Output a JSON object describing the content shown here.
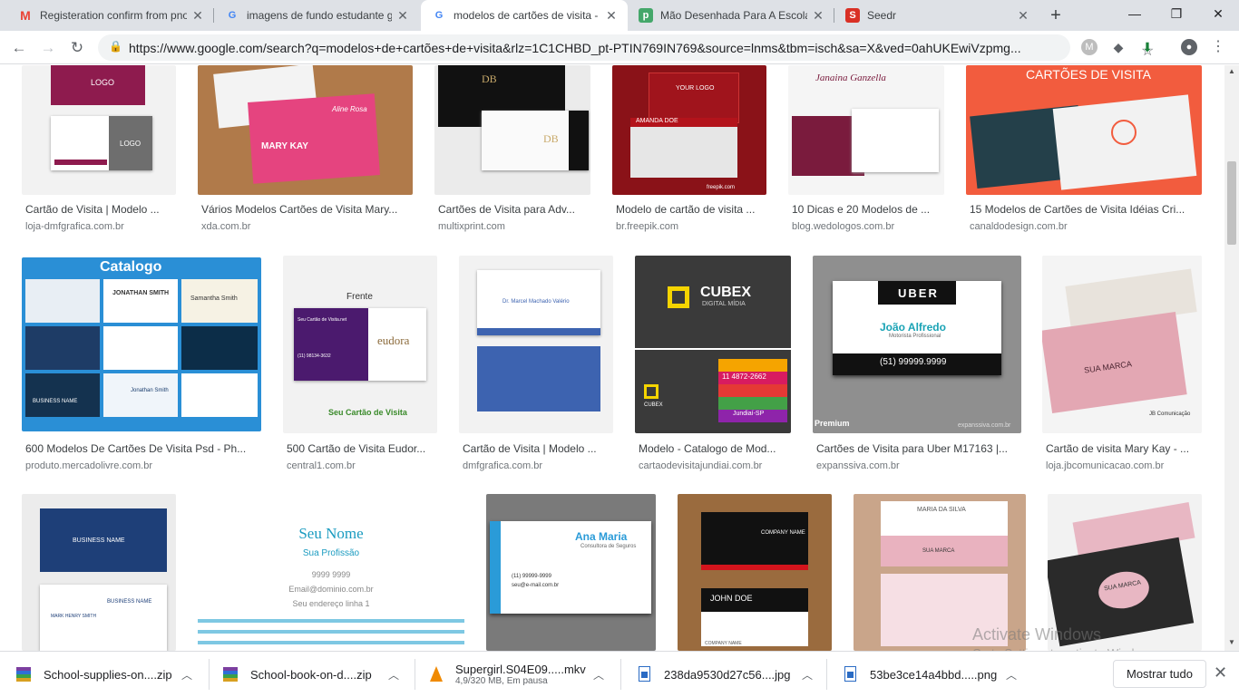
{
  "tabs": [
    {
      "title": "Registeration confirm from pno",
      "icon": "gmail-icon"
    },
    {
      "title": "imagens de fundo estudante g",
      "icon": "google-icon"
    },
    {
      "title": "modelos de cartões de visita -",
      "icon": "google-icon"
    },
    {
      "title": "Mão Desenhada Para A Escola",
      "icon": "freepik-icon"
    },
    {
      "title": "Seedr",
      "icon": "seedr-icon"
    }
  ],
  "url": "https://www.google.com/search?q=modelos+de+cartões+de+visita&rlz=1C1CHBD_pt-PTIN769IN769&source=lnms&tbm=isch&sa=X&ved=0ahUKEwiVzpmg...",
  "results": [
    {
      "caption": "Cartão de Visita | Modelo ...",
      "domain": "loja-dmfgrafica.com.br",
      "texts": [
        "LOGO",
        "LOGO"
      ]
    },
    {
      "caption": "Vários Modelos Cartões de Visita Mary...",
      "domain": "xda.com.br",
      "texts": [
        "MARY KAY",
        "Aline Rosa"
      ]
    },
    {
      "caption": "Cartões de Visita para Adv...",
      "domain": "multixprint.com",
      "texts": [
        "DB",
        "DB"
      ]
    },
    {
      "caption": "Modelo de cartão de visita ...",
      "domain": "br.freepik.com",
      "texts": [
        "YOUR LOGO",
        "AMANDA DOE",
        "freepik.com"
      ]
    },
    {
      "caption": "10 Dicas e 20 Modelos de ...",
      "domain": "blog.wedologos.com.br",
      "texts": [
        "Janaina Ganzella"
      ]
    },
    {
      "caption": "15 Modelos de Cartões de Visita Idéias Cri...",
      "domain": "canaldodesign.com.br",
      "texts": [
        "CARTÕES DE VISITA"
      ]
    },
    {
      "caption": "600 Modelos De Cartões De Visita Psd - Ph...",
      "domain": "produto.mercadolivre.com.br",
      "texts": [
        "Catalogo",
        "JONATHAN SMITH",
        "Samantha Smith",
        "Jonathan Smith",
        "BUSINESS NAME"
      ]
    },
    {
      "caption": "500 Cartão de Visita Eudor...",
      "domain": "central1.com.br",
      "texts": [
        "Frente",
        "Seu Cartão de Visita.net",
        "eudora",
        "(11) 98134-3632",
        "Seu Cartão de Visita"
      ]
    },
    {
      "caption": "Cartão de Visita | Modelo ...",
      "domain": "dmfgrafica.com.br",
      "texts": [
        "Dr. Marcel Machado Valério"
      ]
    },
    {
      "caption": "Modelo - Catalogo de Mod...",
      "domain": "cartaodevisitajundiai.com.br",
      "texts": [
        "CUBEX",
        "DIGITAL MÍDIA",
        "11 4872-2662",
        "CUBEX",
        "Jundiaí-SP"
      ]
    },
    {
      "caption": "Cartões de Visita para Uber M17163 |...",
      "domain": "expanssiva.com.br",
      "texts": [
        "UBER",
        "João Alfredo",
        "Motorista Profissional",
        "(51) 99999.9999",
        "Premium",
        "expanssiva.com.br"
      ]
    },
    {
      "caption": "Cartão de visita Mary Kay - ...",
      "domain": "loja.jbcomunicacao.com.br",
      "texts": [
        "SUA MARCA",
        "JB Comunicação"
      ]
    },
    {
      "caption": "",
      "domain": "",
      "texts": [
        "BUSINESS NAME",
        "BUSINESS NAME",
        "MARK HENRY SMITH"
      ]
    },
    {
      "caption": "",
      "domain": "",
      "texts": [
        "Seu Nome",
        "Sua Profissão",
        "9999 9999",
        "Email@dominio.com.br",
        "Seu endereço linha 1"
      ]
    },
    {
      "caption": "",
      "domain": "",
      "texts": [
        "Ana Maria",
        "Consultora de Seguros",
        "(11) 99999-9999",
        "seu@e-mail.com.br"
      ]
    },
    {
      "caption": "",
      "domain": "",
      "texts": [
        "COMPANY NAME",
        "JOHN DOE",
        "COMPANY NAME"
      ]
    },
    {
      "caption": "",
      "domain": "",
      "texts": [
        "MARIA DA SILVA",
        "SUA MARCA"
      ]
    },
    {
      "caption": "",
      "domain": "",
      "texts": [
        "SUA MARCA"
      ]
    }
  ],
  "downloads": [
    {
      "name": "School-supplies-on....zip",
      "sub": ""
    },
    {
      "name": "School-book-on-d....zip",
      "sub": ""
    },
    {
      "name": "Supergirl.S04E09.....mkv",
      "sub": "4,9/320 MB, Em pausa"
    },
    {
      "name": "238da9530d27c56....jpg",
      "sub": ""
    },
    {
      "name": "53be3ce14a4bbd.....png",
      "sub": ""
    }
  ],
  "show_all_label": "Mostrar tudo",
  "watermark": {
    "line1": "Activate Windows",
    "line2": "Go to Settings to activate Windows."
  },
  "colors": {
    "tabstrip": "#dee1e6",
    "accent": "#1a73e8"
  }
}
